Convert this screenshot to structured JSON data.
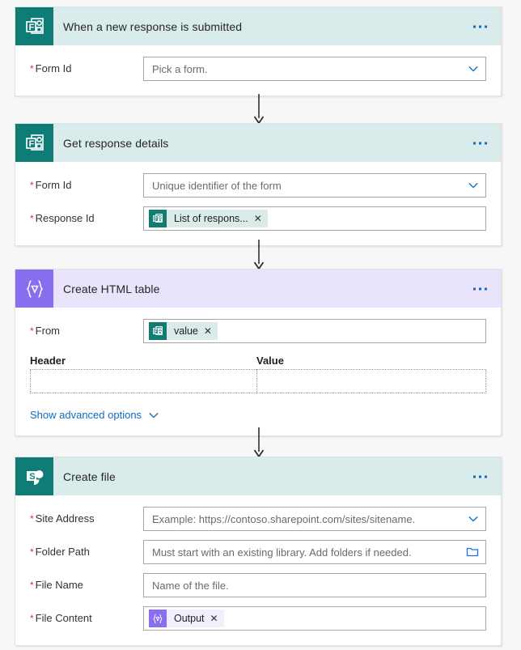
{
  "flow": {
    "cards": [
      {
        "id": "trigger-forms",
        "title": "When a new response is submitted",
        "icon": "microsoft-forms-icon",
        "theme": "teal",
        "menu_label": "...",
        "fields": [
          {
            "label": "Form Id",
            "required": true,
            "type": "dropdown",
            "value": "",
            "placeholder": "Pick a form."
          }
        ]
      },
      {
        "id": "get-response-details",
        "title": "Get response details",
        "icon": "microsoft-forms-icon",
        "theme": "teal",
        "menu_label": "...",
        "fields": [
          {
            "label": "Form Id",
            "required": true,
            "type": "dropdown",
            "value": "",
            "placeholder": "Unique identifier of the form"
          },
          {
            "label": "Response Id",
            "required": true,
            "type": "token",
            "token": {
              "text": "List of respons...",
              "icon": "microsoft-forms-icon",
              "theme": "teal",
              "remove_label": "✕"
            }
          }
        ]
      },
      {
        "id": "create-html-table",
        "title": "Create HTML table",
        "icon": "data-operations-icon",
        "theme": "purple",
        "menu_label": "...",
        "fields": [
          {
            "label": "From",
            "required": true,
            "type": "token",
            "token": {
              "text": "value",
              "icon": "microsoft-forms-icon",
              "theme": "teal",
              "remove_label": "✕"
            }
          }
        ],
        "kv_table": {
          "columns": [
            "Header",
            "Value"
          ],
          "rows": [
            {
              "header": "",
              "value": ""
            }
          ]
        },
        "advanced_options_label": "Show advanced options"
      },
      {
        "id": "create-file",
        "title": "Create file",
        "icon": "sharepoint-icon",
        "theme": "teal",
        "menu_label": "...",
        "fields": [
          {
            "label": "Site Address",
            "required": true,
            "type": "dropdown",
            "value": "",
            "placeholder": "Example: https://contoso.sharepoint.com/sites/sitename."
          },
          {
            "label": "Folder Path",
            "required": true,
            "type": "folder",
            "value": "",
            "placeholder": "Must start with an existing library. Add folders if needed."
          },
          {
            "label": "File Name",
            "required": true,
            "type": "text",
            "value": "",
            "placeholder": "Name of the file."
          },
          {
            "label": "File Content",
            "required": true,
            "type": "token",
            "token": {
              "text": "Output",
              "icon": "data-operations-icon",
              "theme": "purple",
              "remove_label": "✕"
            }
          }
        ]
      }
    ],
    "required_marker": "*",
    "colors": {
      "teal_header": "#d9ebea",
      "teal_tile": "#0f7c76",
      "purple_header": "#e9e3fc",
      "purple_tile": "#8a6ef0",
      "link_blue": "#0f6cbd",
      "required_red": "#d13438",
      "canvas": "#f7f7f7"
    }
  }
}
